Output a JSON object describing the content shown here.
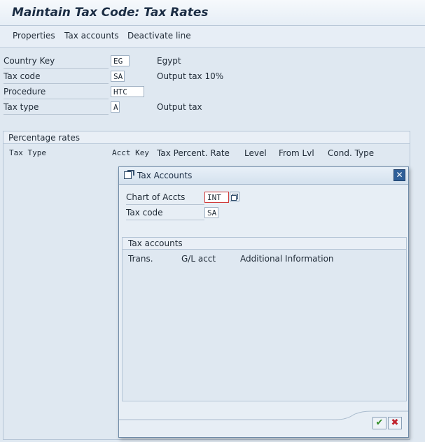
{
  "header": {
    "title": "Maintain Tax Code: Tax Rates"
  },
  "toolbar": {
    "items": [
      "Properties",
      "Tax accounts",
      "Deactivate line"
    ]
  },
  "fields": {
    "country_key": {
      "label": "Country Key",
      "value": "EG",
      "description": "Egypt"
    },
    "tax_code": {
      "label": "Tax code",
      "value": "SA",
      "description": "Output tax 10%"
    },
    "procedure": {
      "label": "Procedure",
      "value": "HTC"
    },
    "tax_type": {
      "label": "Tax type",
      "value": "A",
      "description": "Output tax"
    }
  },
  "percentage_rates": {
    "title": "Percentage rates",
    "columns": [
      "Tax Type",
      "Acct Key",
      "Tax Percent. Rate",
      "Level",
      "From Lvl",
      "Cond. Type"
    ]
  },
  "dialog": {
    "title": "Tax Accounts",
    "close_icon": "close-icon",
    "chart_of_accts": {
      "label": "Chart of Accts",
      "value": "INT"
    },
    "tax_code": {
      "label": "Tax code",
      "value": "SA"
    },
    "tax_accounts": {
      "title": "Tax accounts",
      "columns": [
        "Trans.",
        "G/L acct",
        "Additional Information"
      ]
    },
    "ok_icon": "checkmark-icon",
    "cancel_icon": "cancel-x-icon"
  }
}
